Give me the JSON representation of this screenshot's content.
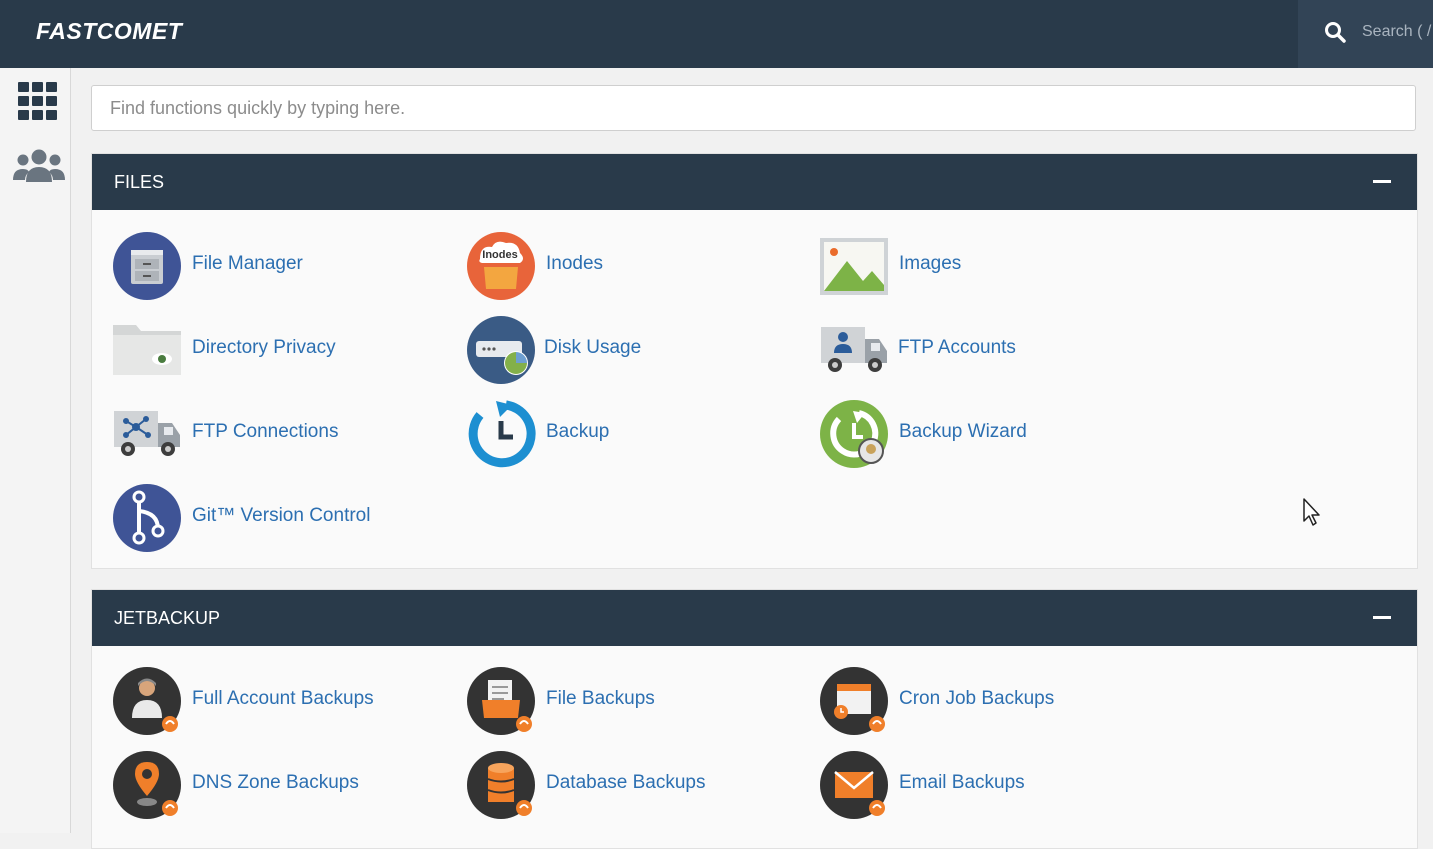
{
  "header": {
    "logo": "FASTCOMET",
    "search_label": "Search ( /"
  },
  "sidebar": {
    "items": [
      {
        "name": "apps-grid-icon"
      },
      {
        "name": "users-icon"
      }
    ]
  },
  "quick_search": {
    "placeholder": "Find functions quickly by typing here."
  },
  "sections": [
    {
      "title": "FILES",
      "items": [
        {
          "label": "File Manager",
          "icon": "file-cabinet-icon"
        },
        {
          "label": "Inodes",
          "icon": "inodes-icon",
          "badge": "Inodes"
        },
        {
          "label": "Images",
          "icon": "images-icon"
        },
        {
          "label": "Directory Privacy",
          "icon": "folder-eye-icon"
        },
        {
          "label": "Disk Usage",
          "icon": "disk-usage-icon"
        },
        {
          "label": "FTP Accounts",
          "icon": "ftp-truck-user-icon"
        },
        {
          "label": "FTP Connections",
          "icon": "ftp-truck-network-icon"
        },
        {
          "label": "Backup",
          "icon": "backup-clock-icon"
        },
        {
          "label": "Backup Wizard",
          "icon": "backup-wizard-icon"
        },
        {
          "label": "Git™ Version Control",
          "icon": "git-branch-icon"
        }
      ]
    },
    {
      "title": "JETBACKUP",
      "items": [
        {
          "label": "Full Account Backups",
          "icon": "full-account-backup-icon"
        },
        {
          "label": "File Backups",
          "icon": "file-backup-icon"
        },
        {
          "label": "Cron Job Backups",
          "icon": "cron-backup-icon"
        },
        {
          "label": "DNS Zone Backups",
          "icon": "dns-backup-icon"
        },
        {
          "label": "Database Backups",
          "icon": "database-backup-icon"
        },
        {
          "label": "Email Backups",
          "icon": "email-backup-icon"
        }
      ]
    }
  ]
}
